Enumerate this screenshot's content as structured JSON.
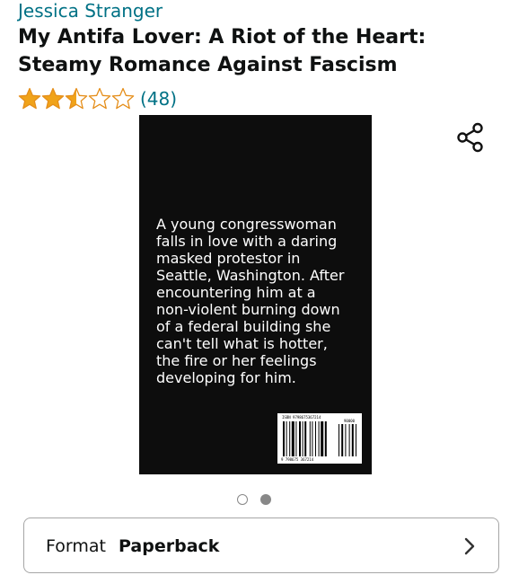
{
  "product": {
    "author": "Jessica Stranger",
    "title": "My Antifa Lover: A Riot of the Heart: Steamy Romance Against Fascism",
    "rating": {
      "stars": 2.5,
      "max_stars": 5,
      "count_text": "(48)",
      "star_color": "#F0A31A",
      "star_outline_color": "#E58E1A"
    },
    "share_icon": "share-icon"
  },
  "cover": {
    "blurb": "A young congresswoman\nfalls in love with a daring\nmasked protestor in\nSeattle, Washington. After\nencountering him at a\nnon-violent burning down\nof a federal building she\ncan't tell what is hotter,\nthe fire or her feelings\ndeveloping for him.",
    "isbn_text": "ISBN 9798675367214",
    "price_code": "90000",
    "barcode_number": "9 798675 367214"
  },
  "carousel": {
    "total": 2,
    "active_index": 1
  },
  "format": {
    "label": "Format",
    "value": "Paperback",
    "chevron_icon": "chevron-right-icon"
  },
  "colors": {
    "link": "#007185",
    "text": "#0F1111",
    "cover_bg": "#0D0D0D"
  }
}
